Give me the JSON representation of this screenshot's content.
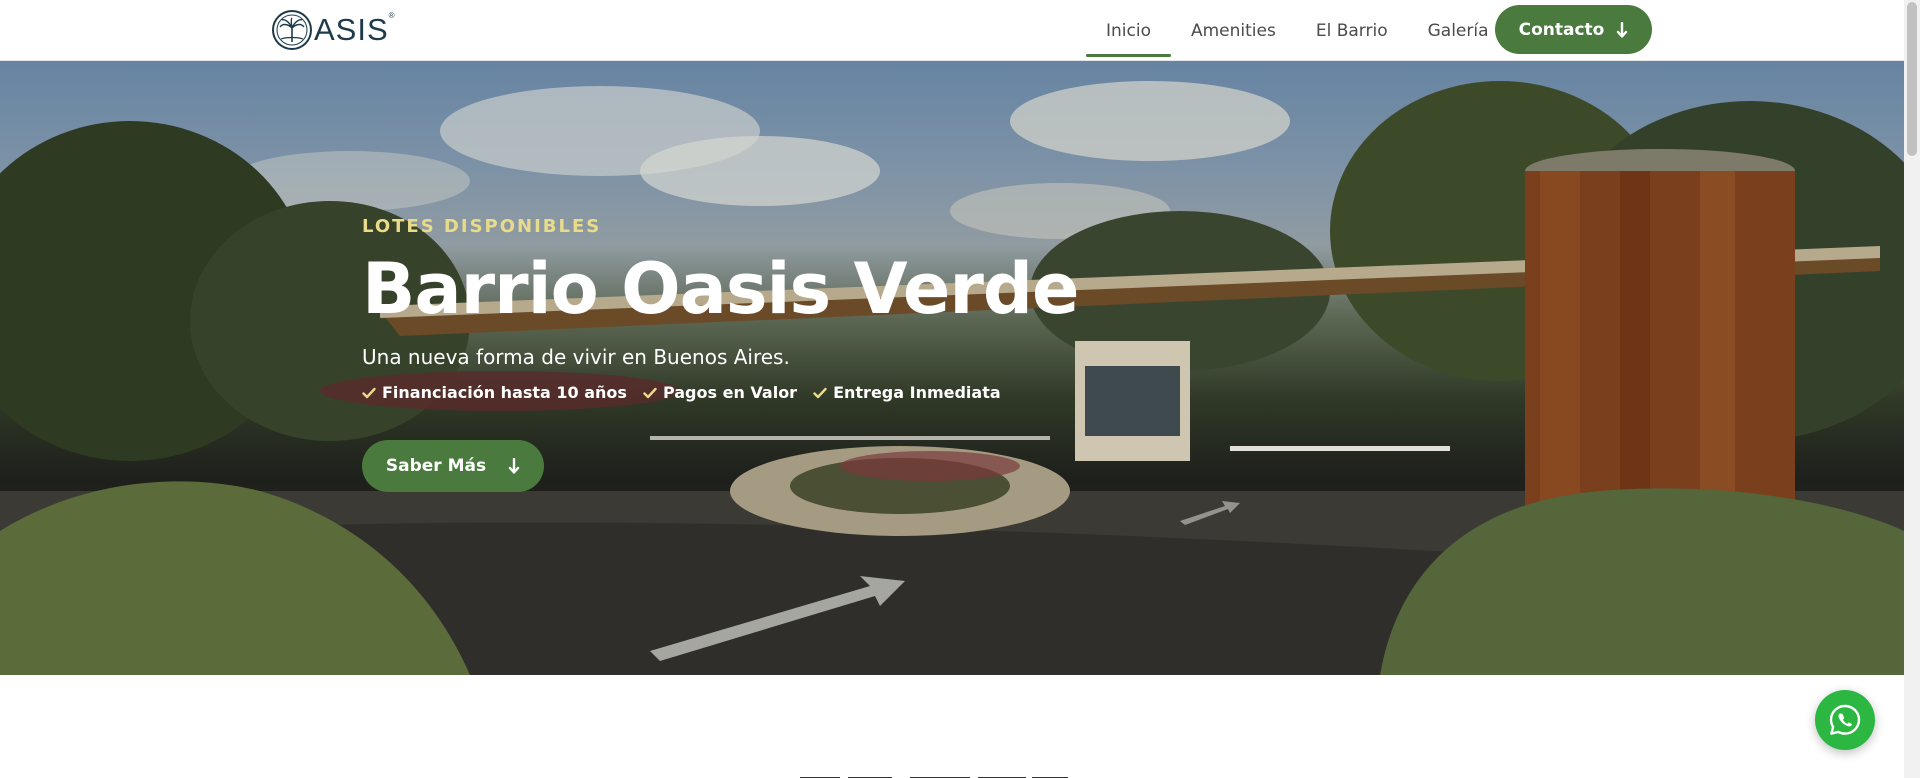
{
  "header": {
    "logo_text": "ASIS",
    "logo_reg": "®",
    "nav": [
      {
        "label": "Inicio",
        "active": true
      },
      {
        "label": "Amenities",
        "active": false
      },
      {
        "label": "El Barrio",
        "active": false
      },
      {
        "label": "Galería",
        "active": false
      }
    ],
    "contact_label": "Contacto",
    "contact_icon": "arrow-down-icon"
  },
  "hero": {
    "eyebrow": "LOTES DISPONIBLES",
    "title": "Barrio Oasis Verde",
    "subtitle": "Una nueva forma de vivir en Buenos Aires.",
    "features": [
      "Financiación hasta 10 años",
      "Pagos en Valor",
      "Entrega Inmediata"
    ],
    "feature_icon": "check-icon",
    "cta_label": "Saber Más",
    "cta_icon": "arrow-down-icon"
  },
  "floating": {
    "whatsapp_icon": "whatsapp-icon"
  },
  "colors": {
    "brand_green": "#4a7a3e",
    "eyebrow_gold": "#e9db8a",
    "whatsapp_green": "#2bb742",
    "logo_navy": "#1d3b4a"
  }
}
